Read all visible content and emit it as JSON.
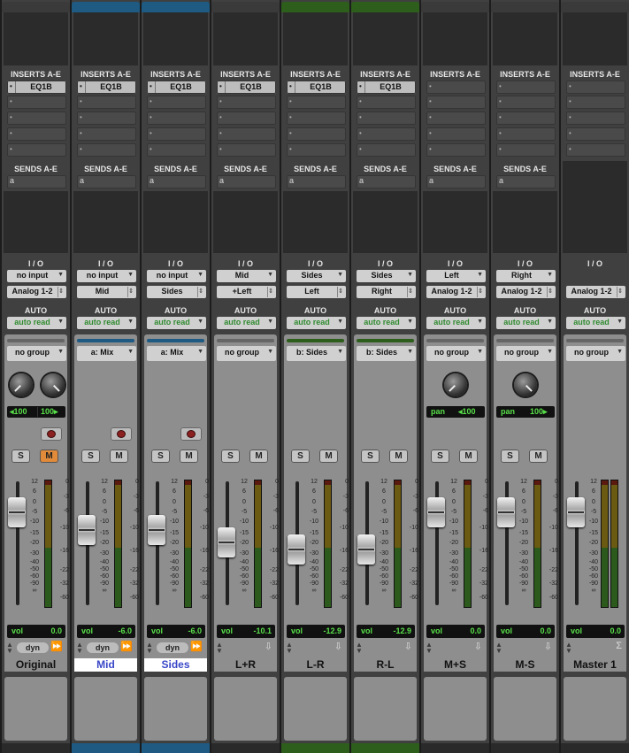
{
  "mixer": {
    "labels": {
      "inserts": "INSERTS A-E",
      "sends": "SENDS A-E",
      "io": "I / O",
      "auto": "AUTO",
      "solo": "S",
      "mute": "M",
      "vol": "vol",
      "dyn": "dyn",
      "pan_left": "pan",
      "slot_dot": "•",
      "send_a": "a"
    },
    "fader_scale": [
      "12",
      "6",
      "0",
      "-5",
      "-10",
      "-15",
      "-20",
      "-30",
      "-40",
      "-50",
      "-60",
      "-90",
      "∞"
    ],
    "meter_scale": [
      "0",
      "-3",
      "-6",
      "-10",
      "-16",
      "-22",
      "-32",
      "-60"
    ],
    "tracks": [
      {
        "name": "Original",
        "color": "#3a3a3a",
        "insert": "EQ1B",
        "send": "a",
        "input": "no input",
        "output": "Analog 1-2",
        "auto": "auto read",
        "group": "no group",
        "pan_l": "◂100",
        "pan_r": "100▸",
        "vol": "0.0",
        "mute_active": true,
        "selected": false,
        "has_rec": true
      },
      {
        "name": "Mid",
        "color": "#1e5a82",
        "insert": "EQ1B",
        "send": "a",
        "input": "no input",
        "output": "Mid",
        "auto": "auto read",
        "group": "a: Mix",
        "pan_l": "",
        "pan_r": "",
        "vol": "-6.0",
        "mute_active": false,
        "selected": true,
        "has_rec": true
      },
      {
        "name": "Sides",
        "color": "#1e5a82",
        "insert": "EQ1B",
        "send": "a",
        "input": "no input",
        "output": "Sides",
        "auto": "auto read",
        "group": "a: Mix",
        "pan_l": "",
        "pan_r": "",
        "vol": "-6.0",
        "mute_active": false,
        "selected": true,
        "has_rec": true
      },
      {
        "name": "L+R",
        "color": "#3a3a3a",
        "insert": "EQ1B",
        "send": "a",
        "input": "Mid",
        "output": "+Left",
        "auto": "auto read",
        "group": "no group",
        "pan_l": "",
        "pan_r": "",
        "vol": "-10.1",
        "mute_active": false,
        "selected": false,
        "has_rec": false
      },
      {
        "name": "L-R",
        "color": "#2e5e1c",
        "insert": "EQ1B",
        "send": "a",
        "input": "Sides",
        "output": "Left",
        "auto": "auto read",
        "group": "b: Sides",
        "pan_l": "",
        "pan_r": "",
        "vol": "-12.9",
        "mute_active": false,
        "selected": false,
        "has_rec": false
      },
      {
        "name": "R-L",
        "color": "#2e5e1c",
        "insert": "EQ1B",
        "send": "a",
        "input": "Sides",
        "output": "Right",
        "auto": "auto read",
        "group": "b: Sides",
        "pan_l": "",
        "pan_r": "",
        "vol": "-12.9",
        "mute_active": false,
        "selected": false,
        "has_rec": false
      },
      {
        "name": "M+S",
        "color": "#3a3a3a",
        "insert": "",
        "send": "a",
        "input": "Left",
        "output": "Analog 1-2",
        "auto": "auto read",
        "group": "no group",
        "pan_l": "pan",
        "pan_r": "◂100",
        "vol": "0.0",
        "mute_active": false,
        "selected": false,
        "has_rec": false
      },
      {
        "name": "M-S",
        "color": "#3a3a3a",
        "insert": "",
        "send": "a",
        "input": "Right",
        "output": "Analog 1-2",
        "auto": "auto read",
        "group": "no group",
        "pan_l": "pan",
        "pan_r": "100▸",
        "vol": "0.0",
        "mute_active": false,
        "selected": false,
        "has_rec": false
      },
      {
        "name": "Master 1",
        "color": "#3a3a3a",
        "insert": "",
        "send": "",
        "input": "",
        "output": "Analog 1-2",
        "auto": "auto read",
        "group": "no group",
        "pan_l": "",
        "pan_r": "",
        "vol": "0.0",
        "mute_active": false,
        "selected": false,
        "has_rec": false
      }
    ]
  }
}
